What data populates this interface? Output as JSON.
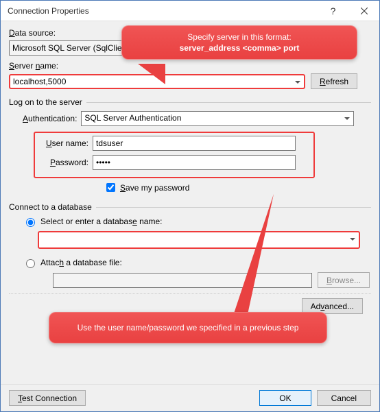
{
  "title": "Connection Properties",
  "labels": {
    "data_source": "Data source:",
    "server_name": "Server name:",
    "refresh": "Refresh",
    "logon_section": "Log on to the server",
    "authentication": "Authentication:",
    "user_name": "User name:",
    "password": "Password:",
    "save_password": "Save my password",
    "connect_section": "Connect to a database",
    "select_db": "Select or enter a database name:",
    "attach_db": "Attach a database file:",
    "browse": "Browse...",
    "advanced": "Advanced...",
    "test_connection": "Test Connection",
    "ok": "OK",
    "cancel": "Cancel"
  },
  "mnemonics": {
    "data_source_u": "D",
    "server_name_u": "S",
    "refresh_u": "R",
    "authentication_u": "A",
    "user_name_u": "U",
    "password_u": "P",
    "save_password_u": "S",
    "select_db_u": "e",
    "attach_db_u": "h",
    "browse_u": "B",
    "advanced_u": "v",
    "test_connection_u": "T"
  },
  "values": {
    "data_source": "Microsoft SQL Server (SqlClient)",
    "server_name": "localhost,5000",
    "authentication": "SQL Server Authentication",
    "user_name": "tdsuser",
    "password": "•••••",
    "save_password_checked": true,
    "db_mode": "select",
    "database_name": "",
    "attach_file": ""
  },
  "callouts": {
    "c1_line1": "Specify server in this format:",
    "c1_line2": "server_address <comma> port",
    "c2": "Use the user name/password we specified in a previous step"
  }
}
